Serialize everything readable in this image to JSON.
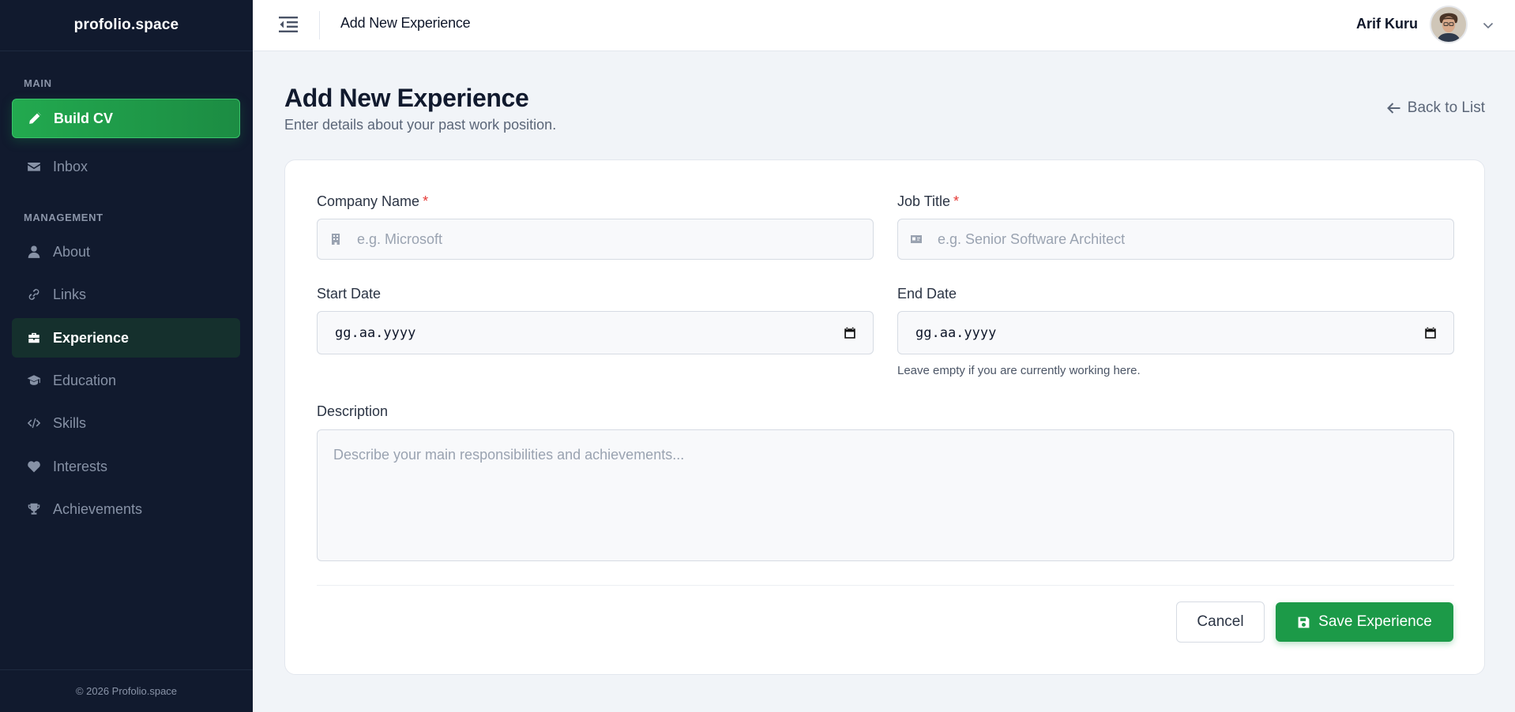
{
  "brand": {
    "name": "profolio.space"
  },
  "sidebar": {
    "sections": {
      "main": "MAIN",
      "management": "MANAGEMENT"
    },
    "items": [
      {
        "label": "Build CV",
        "icon": "pencil-icon"
      },
      {
        "label": "Inbox",
        "icon": "envelope-icon"
      },
      {
        "label": "About",
        "icon": "user-icon"
      },
      {
        "label": "Links",
        "icon": "link-icon"
      },
      {
        "label": "Experience",
        "icon": "briefcase-icon"
      },
      {
        "label": "Education",
        "icon": "graduation-cap-icon"
      },
      {
        "label": "Skills",
        "icon": "code-icon"
      },
      {
        "label": "Interests",
        "icon": "heart-icon"
      },
      {
        "label": "Achievements",
        "icon": "trophy-icon"
      }
    ],
    "active_item": "Experience",
    "footer": "© 2026 Profolio.space"
  },
  "topbar": {
    "title": "Add New Experience",
    "user_name": "Arif Kuru"
  },
  "page": {
    "title": "Add New Experience",
    "subtitle": "Enter details about your past work position.",
    "back_label": "Back to List"
  },
  "form": {
    "company": {
      "label": "Company Name",
      "required_mark": "*",
      "placeholder": "e.g. Microsoft"
    },
    "job_title": {
      "label": "Job Title",
      "required_mark": "*",
      "placeholder": "e.g. Senior Software Architect"
    },
    "start_date": {
      "label": "Start Date",
      "value": "gg.aa.yyyy"
    },
    "end_date": {
      "label": "End Date",
      "value": "gg.aa.yyyy",
      "hint": "Leave empty if you are currently working here."
    },
    "description": {
      "label": "Description",
      "placeholder": "Describe your main responsibilities and achievements..."
    },
    "cancel_label": "Cancel",
    "save_label": "Save Experience"
  },
  "colors": {
    "sidebar_bg": "#111a2e",
    "accent_green": "#1c9a48",
    "active_item_bg": "#15302d",
    "required": "#e53935",
    "page_bg": "#f1f4f8"
  }
}
